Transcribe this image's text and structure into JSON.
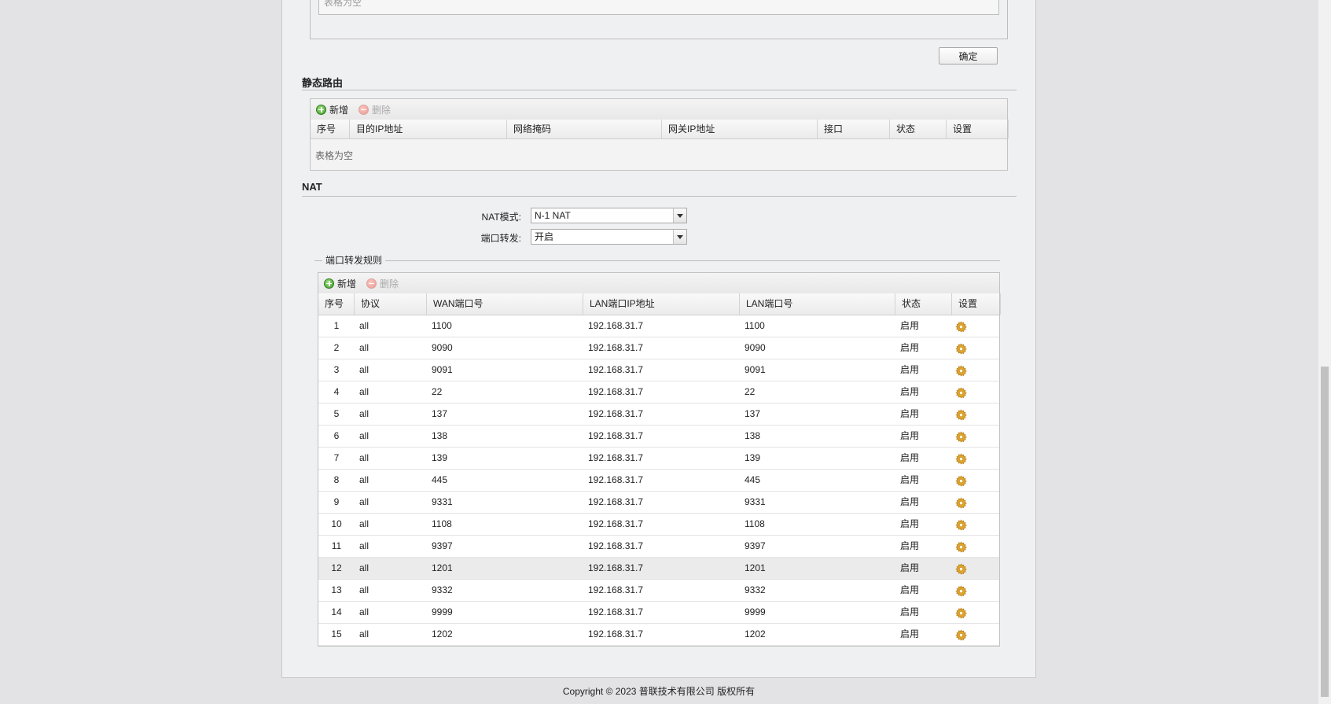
{
  "top_section": {
    "placeholder_text": "表格为空",
    "confirm_label": "确定"
  },
  "static_route": {
    "title": "静态路由",
    "toolbar": {
      "add_label": "新增",
      "delete_label": "删除"
    },
    "columns": [
      "序号",
      "目的IP地址",
      "网络掩码",
      "网关IP地址",
      "接口",
      "状态",
      "设置"
    ],
    "empty_text": "表格为空"
  },
  "nat": {
    "title": "NAT",
    "mode_label": "NAT模式:",
    "mode_value": "N-1 NAT",
    "forward_label": "端口转发:",
    "forward_value": "开启",
    "rules_legend": "端口转发规则",
    "toolbar": {
      "add_label": "新增",
      "delete_label": "删除"
    },
    "columns": [
      "序号",
      "协议",
      "WAN端口号",
      "LAN端口IP地址",
      "LAN端口号",
      "状态",
      "设置"
    ],
    "rows": [
      {
        "no": "1",
        "proto": "all",
        "wan": "1100",
        "ip": "192.168.31.7",
        "lan": "1100",
        "status": "启用"
      },
      {
        "no": "2",
        "proto": "all",
        "wan": "9090",
        "ip": "192.168.31.7",
        "lan": "9090",
        "status": "启用"
      },
      {
        "no": "3",
        "proto": "all",
        "wan": "9091",
        "ip": "192.168.31.7",
        "lan": "9091",
        "status": "启用"
      },
      {
        "no": "4",
        "proto": "all",
        "wan": "22",
        "ip": "192.168.31.7",
        "lan": "22",
        "status": "启用"
      },
      {
        "no": "5",
        "proto": "all",
        "wan": "137",
        "ip": "192.168.31.7",
        "lan": "137",
        "status": "启用"
      },
      {
        "no": "6",
        "proto": "all",
        "wan": "138",
        "ip": "192.168.31.7",
        "lan": "138",
        "status": "启用"
      },
      {
        "no": "7",
        "proto": "all",
        "wan": "139",
        "ip": "192.168.31.7",
        "lan": "139",
        "status": "启用"
      },
      {
        "no": "8",
        "proto": "all",
        "wan": "445",
        "ip": "192.168.31.7",
        "lan": "445",
        "status": "启用"
      },
      {
        "no": "9",
        "proto": "all",
        "wan": "9331",
        "ip": "192.168.31.7",
        "lan": "9331",
        "status": "启用"
      },
      {
        "no": "10",
        "proto": "all",
        "wan": "1108",
        "ip": "192.168.31.7",
        "lan": "1108",
        "status": "启用"
      },
      {
        "no": "11",
        "proto": "all",
        "wan": "9397",
        "ip": "192.168.31.7",
        "lan": "9397",
        "status": "启用"
      },
      {
        "no": "12",
        "proto": "all",
        "wan": "1201",
        "ip": "192.168.31.7",
        "lan": "1201",
        "status": "启用"
      },
      {
        "no": "13",
        "proto": "all",
        "wan": "9332",
        "ip": "192.168.31.7",
        "lan": "9332",
        "status": "启用"
      },
      {
        "no": "14",
        "proto": "all",
        "wan": "9999",
        "ip": "192.168.31.7",
        "lan": "9999",
        "status": "启用"
      },
      {
        "no": "15",
        "proto": "all",
        "wan": "1202",
        "ip": "192.168.31.7",
        "lan": "1202",
        "status": "启用"
      }
    ],
    "highlighted_row": "12"
  },
  "footer": {
    "copyright": "Copyright © 2023 普联技术有限公司 版权所有"
  },
  "colors": {
    "gear_icon": "#e0a52a",
    "add_icon": "#3c9a2a",
    "delete_icon": "#e99a93"
  }
}
